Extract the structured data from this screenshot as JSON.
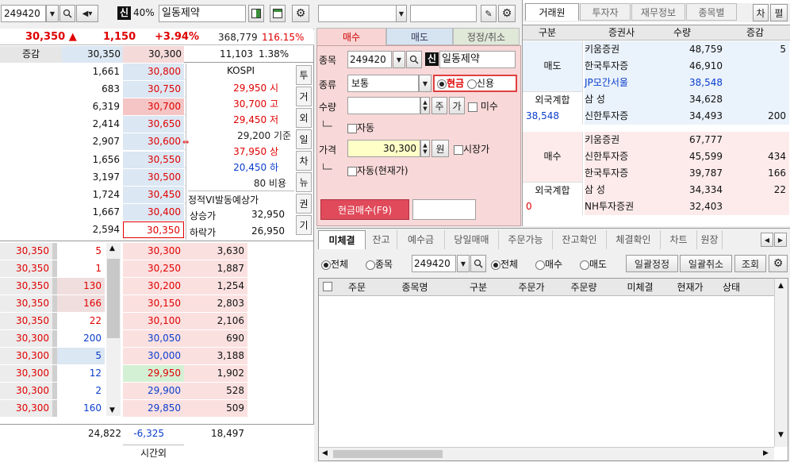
{
  "left": {
    "code": "249420",
    "pct_tag": "40%",
    "name": "일동제약",
    "credit_tag": "신",
    "summary": {
      "price": "30,350 ▲",
      "change": "1,150",
      "rate": "+3.94%",
      "volume": "368,779",
      "vol_ratio": "116.15%"
    },
    "header2": {
      "label": "증감",
      "sell": "30,350",
      "buy": "30,300",
      "qty": "11,103",
      "ratio": "1.38%"
    },
    "asks": [
      {
        "qty": "1,661",
        "price": "30,800"
      },
      {
        "qty": "683",
        "price": "30,750"
      },
      {
        "qty": "6,319",
        "price": "30,700"
      },
      {
        "qty": "2,414",
        "price": "30,650"
      },
      {
        "qty": "2,907",
        "price": "30,600"
      },
      {
        "qty": "1,656",
        "price": "30,550"
      },
      {
        "qty": "3,197",
        "price": "30,500"
      },
      {
        "qty": "1,724",
        "price": "30,450"
      },
      {
        "qty": "1,667",
        "price": "30,400"
      },
      {
        "qty": "2,594",
        "price": "30,350"
      }
    ],
    "bids": [
      {
        "trade": "30,350",
        "tqty": "5",
        "price": "30,300",
        "qty": "3,630"
      },
      {
        "trade": "30,350",
        "tqty": "1",
        "price": "30,250",
        "qty": "1,887"
      },
      {
        "trade": "30,350",
        "tqty": "130",
        "price": "30,200",
        "qty": "1,254"
      },
      {
        "trade": "30,350",
        "tqty": "166",
        "price": "30,150",
        "qty": "2,803"
      },
      {
        "trade": "30,350",
        "tqty": "22",
        "price": "30,100",
        "qty": "2,106"
      },
      {
        "trade": "30,300",
        "tqty": "200",
        "price": "30,050",
        "qty": "690"
      },
      {
        "trade": "30,300",
        "tqty": "5",
        "price": "30,000",
        "qty": "3,188"
      },
      {
        "trade": "30,300",
        "tqty": "12",
        "price": "29,950",
        "qty": "1,902"
      },
      {
        "trade": "30,300",
        "tqty": "2",
        "price": "29,900",
        "qty": "528"
      },
      {
        "trade": "30,300",
        "tqty": "160",
        "price": "29,850",
        "qty": "509"
      }
    ],
    "info": {
      "market": "KOSPI",
      "open": "29,950 시",
      "high": "30,700 고",
      "low": "29,450 저",
      "base": "29,200 기준",
      "upper": "37,950 상",
      "lower": "20,450 하",
      "cost": "80 비용",
      "vi_label": "정적VI발동예상가",
      "up_label": "상승가",
      "up_val": "32,950",
      "down_label": "하락가",
      "down_val": "26,950"
    },
    "side_tabs": [
      "투",
      "거",
      "외",
      "일",
      "차",
      "뉴",
      "권",
      "기"
    ],
    "footer": {
      "ask_total": "24,822",
      "diff": "-6,325",
      "bid_total": "18,497",
      "afterhours": "시간외"
    }
  },
  "order": {
    "tabs": [
      "매수",
      "매도",
      "정정/취소"
    ],
    "labels": {
      "code": "종목",
      "type": "종류",
      "qty": "수량",
      "price": "가격"
    },
    "code": "249420",
    "credit_tag": "신",
    "name": "일동제약",
    "type_value": "보통",
    "cash_label": "현금",
    "credit_label": "신용",
    "unit_btn": "주",
    "ga_btn": "가",
    "misu_label": "미수",
    "auto_label": "자동",
    "price_value": "30,300",
    "won_btn": "원",
    "market_label": "시장가",
    "auto_cur_label": "자동(현재가)",
    "buy_btn": "현금매수(F9)"
  },
  "broker": {
    "tabs": [
      "거래원",
      "투자자",
      "재무정보",
      "종목별"
    ],
    "extra_tabs": [
      "차",
      "펼"
    ],
    "headers": [
      "구분",
      "증권사",
      "수량",
      "증감"
    ],
    "sell_label": "매도",
    "buy_label": "매수",
    "foreign_label": "외국계합",
    "sell_rows": [
      {
        "name": "키움증권",
        "qty": "48,759",
        "chg": "5"
      },
      {
        "name": "한국투자증",
        "qty": "46,910",
        "chg": ""
      },
      {
        "name": "JP모간서울",
        "qty": "38,548",
        "chg": ""
      },
      {
        "name": "삼 성",
        "qty": "34,628",
        "chg": ""
      },
      {
        "name": "신한투자증",
        "qty": "34,493",
        "chg": "200"
      }
    ],
    "sell_foreign": "38,548",
    "buy_rows": [
      {
        "name": "키움증권",
        "qty": "67,777",
        "chg": ""
      },
      {
        "name": "신한투자증",
        "qty": "45,599",
        "chg": "434"
      },
      {
        "name": "한국투자증",
        "qty": "39,787",
        "chg": "166"
      },
      {
        "name": "삼 성",
        "qty": "34,334",
        "chg": "22"
      },
      {
        "name": "NH투자증권",
        "qty": "32,403",
        "chg": ""
      }
    ],
    "buy_foreign": "0"
  },
  "bottom": {
    "tabs": [
      "미체결",
      "잔고",
      "예수금",
      "당일매매",
      "주문가능",
      "잔고확인",
      "체결확인",
      "차트",
      "원장"
    ],
    "filter": {
      "all": "전체",
      "stock": "종목",
      "code": "249420",
      "all2": "전체",
      "buy": "매수",
      "sell": "매도",
      "bulk_edit": "일괄정정",
      "bulk_cancel": "일괄취소",
      "query": "조회"
    },
    "columns": [
      "주문",
      "종목명",
      "구분",
      "주문가",
      "주문량",
      "미체결",
      "현재가",
      "상태"
    ]
  }
}
